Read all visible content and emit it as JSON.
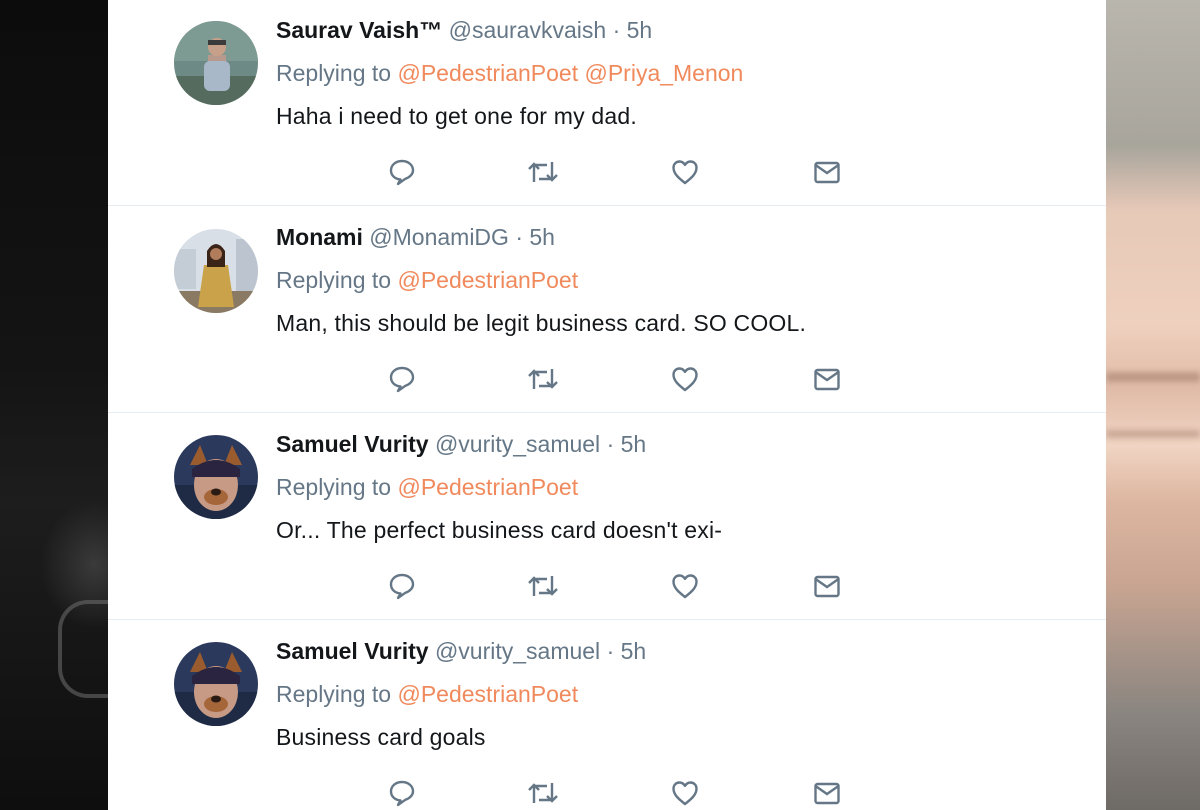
{
  "tweets": [
    {
      "name": "Saurav Vaish™",
      "handle": "@sauravkvaish",
      "dot": "·",
      "time": "5h",
      "replying_label": "Replying to",
      "mentions": [
        "@PedestrianPoet",
        "@Priya_Menon"
      ],
      "text": "Haha i need to get one for my dad."
    },
    {
      "name": "Monami",
      "handle": "@MonamiDG",
      "dot": "·",
      "time": "5h",
      "replying_label": "Replying to",
      "mentions": [
        "@PedestrianPoet"
      ],
      "text": "Man, this should be legit business card. SO COOL."
    },
    {
      "name": "Samuel Vurity",
      "handle": "@vurity_samuel",
      "dot": "·",
      "time": "5h",
      "replying_label": "Replying to",
      "mentions": [
        "@PedestrianPoet"
      ],
      "text": "Or... The perfect business card doesn't exi-"
    },
    {
      "name": "Samuel Vurity",
      "handle": "@vurity_samuel",
      "dot": "·",
      "time": "5h",
      "replying_label": "Replying to",
      "mentions": [
        "@PedestrianPoet"
      ],
      "text": "Business card goals"
    }
  ],
  "icons": {
    "reply": "reply-icon",
    "retweet": "retweet-icon",
    "like": "heart-icon",
    "message": "envelope-icon"
  },
  "colors": {
    "text": "#14171a",
    "muted": "#657786",
    "mention": "#f08a5d",
    "divider": "#e6ecf0"
  }
}
